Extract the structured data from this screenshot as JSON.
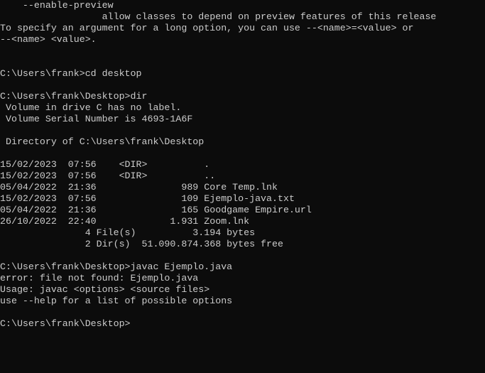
{
  "terminal": {
    "colors": {
      "background": "#0c0c0c",
      "foreground": "#cccccc"
    },
    "lines": [
      "    --enable-preview",
      "                  allow classes to depend on preview features of this release",
      "To specify an argument for a long option, you can use --<name>=<value> or",
      "--<name> <value>.",
      "",
      "",
      "C:\\Users\\frank>cd desktop",
      "",
      "C:\\Users\\frank\\Desktop>dir",
      " Volume in drive C has no label.",
      " Volume Serial Number is 4693-1A6F",
      "",
      " Directory of C:\\Users\\frank\\Desktop",
      "",
      "15/02/2023  07:56    <DIR>          .",
      "15/02/2023  07:56    <DIR>          ..",
      "05/04/2022  21:36               989 Core Temp.lnk",
      "15/02/2023  07:56               109 Ejemplo-java.txt",
      "05/04/2022  21:36               165 Goodgame Empire.url",
      "26/10/2022  22:40             1.931 Zoom.lnk",
      "               4 File(s)          3.194 bytes",
      "               2 Dir(s)  51.090.874.368 bytes free",
      "",
      "C:\\Users\\frank\\Desktop>javac Ejemplo.java",
      "error: file not found: Ejemplo.java",
      "Usage: javac <options> <source files>",
      "use --help for a list of possible options",
      "",
      "C:\\Users\\frank\\Desktop>"
    ]
  }
}
